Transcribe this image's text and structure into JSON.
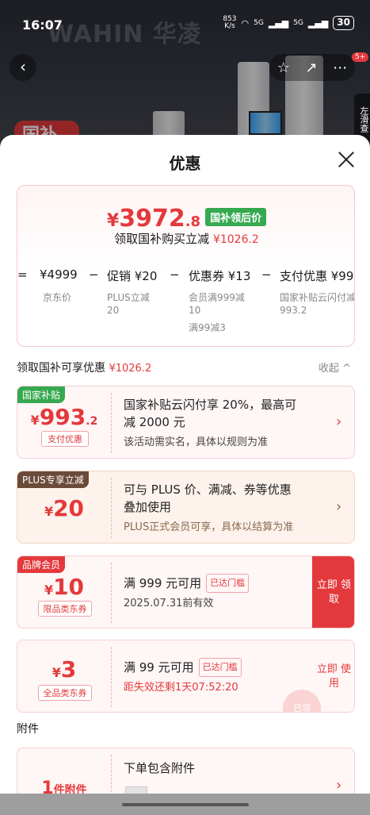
{
  "status": {
    "time": "16:07",
    "left_icons": "N ⓝ ✱ ▯",
    "net_speed_value": "853",
    "net_speed_unit": "K/s",
    "signal1": "5G",
    "signal2": "5G",
    "battery": "30"
  },
  "background": {
    "brand": "WAHIN 华凌",
    "badge_count": "5+",
    "side_tab": "左滑查",
    "promo_text": "国补"
  },
  "sheet": {
    "title": "优惠",
    "summary": {
      "price_yen": "¥",
      "price_int": "3972",
      "price_dec": ".8",
      "price_tag": "国补领后价",
      "save_prefix": "领取国补购买立减",
      "save_amount": "¥1026.2",
      "calc": [
        {
          "op": "=",
          "value": "¥4999",
          "label": "京东价",
          "sub2": ""
        },
        {
          "op": "−",
          "value": "促销 ¥20",
          "label": "PLUS立减",
          "sub2": "20"
        },
        {
          "op": "−",
          "value": "优惠券 ¥13",
          "label": "会员满999减",
          "sub2": "10",
          "sub3": "满99减3"
        },
        {
          "op": "−",
          "value": "支付优惠 ¥99",
          "label": "国家补贴云闪付减",
          "sub2": "993.2"
        }
      ]
    },
    "section_title": "领取国补可享优惠",
    "section_amount": "¥1026.2",
    "collapse_label": "收起 ^",
    "cards": [
      {
        "tag": "国家补贴",
        "yen": "¥",
        "amount": "993",
        "decimal": ".2",
        "chip": "支付优惠",
        "line1": "国家补贴云闪付享 20%，最高可",
        "line2": "减 2000 元",
        "sub": "该活动需实名，具体以规则为准",
        "arrow": "›"
      },
      {
        "tag": "PLUS专享立减",
        "yen": "¥",
        "amount": "20",
        "line1": "可与 PLUS 价、满减、券等优惠",
        "line2": "叠加使用",
        "sub": "PLUS正式会员可享，具体以结算为准",
        "arrow": "›"
      },
      {
        "tag": "品牌会员",
        "yen": "¥",
        "amount": "10",
        "chip": "限品类东券",
        "line1": "满 999 元可用",
        "met": "已达门槛",
        "sub": "2025.07.31前有效",
        "claim": "立即 领取"
      },
      {
        "yen": "¥",
        "amount": "3",
        "chip": "全品类东券",
        "line1": "满 99 元可用",
        "met": "已达门槛",
        "sub": "距失效还剩1天07:52:20",
        "claim": "立即 使用",
        "stamp": "已领"
      }
    ],
    "attachment_title": "附件",
    "attachment": {
      "count": "1",
      "count_label": "件附件",
      "line1": "下单包含附件",
      "arrow": "›"
    }
  }
}
